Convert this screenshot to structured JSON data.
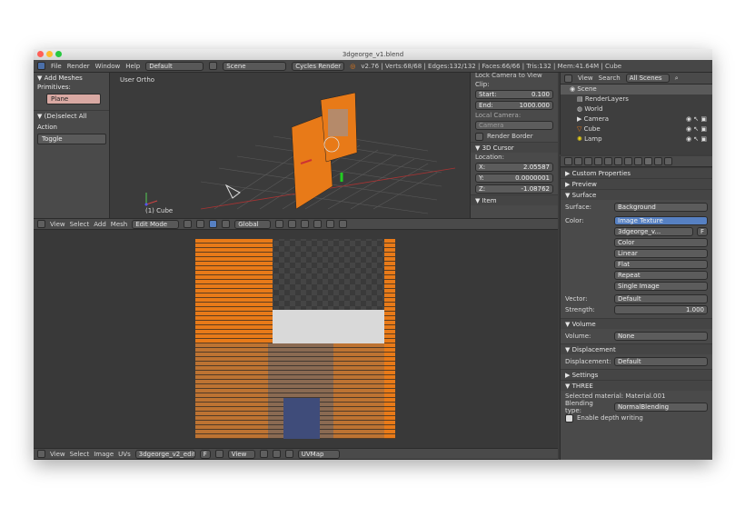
{
  "window": {
    "title": "3dgeorge_v1.blend"
  },
  "menubar": {
    "menus": [
      "File",
      "Render",
      "Window",
      "Help"
    ],
    "layout": "Default",
    "scene": "Scene",
    "engine": "Cycles Render",
    "stats": "v2.76 | Verts:68/68 | Edges:132/132 | Faces:66/66 | Tris:132 | Mem:41.64M | Cube"
  },
  "tools": {
    "add_meshes": "▼ Add Meshes",
    "primitives": "Primitives:",
    "plane": "Plane",
    "deselect_all": "▼ (De)select All",
    "action": "Action",
    "toggle": "Toggle"
  },
  "viewport": {
    "mode_label": "User Ortho",
    "object_label": "(1) Cube"
  },
  "npanel": {
    "lock_camera": "Lock Camera to View",
    "clip": "Clip:",
    "start_label": "Start:",
    "start_value": "0.100",
    "end_label": "End:",
    "end_value": "1000.000",
    "local_camera": "Local Camera:",
    "camera_field": "Camera",
    "render_border": "Render Border",
    "cursor_section": "▼ 3D Cursor",
    "location": "Location:",
    "x_label": "X:",
    "x_value": "2.05587",
    "y_label": "Y:",
    "y_value": "0.0000001",
    "z_label": "Z:",
    "z_value": "-1.08762",
    "item_section": "▼ Item"
  },
  "header3d": {
    "view": "View",
    "select": "Select",
    "add": "Add",
    "mesh": "Mesh",
    "mode": "Edit Mode",
    "orientation": "Global"
  },
  "headeruv": {
    "view": "View",
    "select": "Select",
    "image": "Image",
    "uvs": "UVs",
    "image_name": "3dgeorge_v2_edite...",
    "f": "F",
    "view2": "View",
    "uvmap": "UVMap"
  },
  "outliner": {
    "view": "View",
    "search": "Search",
    "filter": "All Scenes",
    "items": [
      "Scene",
      "RenderLayers",
      "World",
      "Camera",
      "Cube",
      "Lamp"
    ]
  },
  "properties": {
    "custom_props": "▶ Custom Properties",
    "preview": "▶ Preview",
    "surface": "▼ Surface",
    "surface_label": "Surface:",
    "surface_value": "Background",
    "color_label": "Color:",
    "color_value": "Image Texture",
    "image_field": "3dgeorge_v...",
    "image_f": "F",
    "opt_color": "Color",
    "opt_linear": "Linear",
    "opt_flat": "Flat",
    "opt_repeat": "Repeat",
    "opt_single": "Single Image",
    "vector_label": "Vector:",
    "vector_value": "Default",
    "strength_label": "Strength:",
    "strength_value": "1.000",
    "volume": "▼ Volume",
    "volume_label": "Volume:",
    "volume_value": "None",
    "displacement": "▼ Displacement",
    "displacement_label": "Displacement:",
    "displacement_value": "Default",
    "settings": "▶ Settings",
    "three": "▼ THREE",
    "selected_material": "Selected material: Material.001",
    "blending_label": "Blending type:",
    "blending_value": "NormalBlending",
    "depth_write": "Enable depth writing"
  },
  "colors": {
    "accent_orange": "#e87a18",
    "selected_blue": "#5680c2",
    "panel_bg": "#4a4a4a",
    "viewport_bg": "#3b3b3b"
  }
}
